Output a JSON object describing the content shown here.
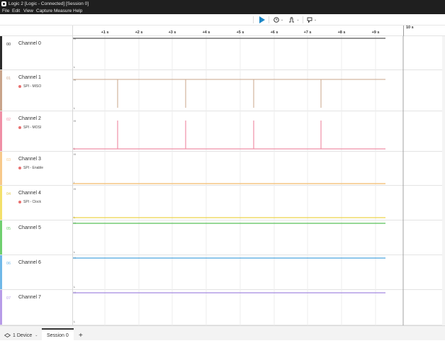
{
  "window": {
    "title": "Logic 2 [Logic - Connected] [Session 0]"
  },
  "menu": [
    "File",
    "Edit",
    "View",
    "Capture",
    "Measure",
    "Help"
  ],
  "toolbar": {
    "start_icon": "play-icon",
    "timer_icon": "clock-icon",
    "trigger_icon": "waveform-trigger-icon",
    "marker_icon": "marker-flag-icon"
  },
  "ruler": {
    "ticks": [
      "+1 s",
      "+2 s",
      "+3 s",
      "+4 s",
      "+5 s",
      "+6 s",
      "+7 s",
      "+8 s",
      "+9 s"
    ],
    "major": "10 s"
  },
  "channels": [
    {
      "num": "00",
      "name": "Channel 0",
      "color": "#2b2b2b",
      "analyzer": "",
      "high": "H",
      "low": "L"
    },
    {
      "num": "01",
      "name": "Channel 1",
      "color": "#c9a48a",
      "analyzer": "SPI - MISO",
      "high": "H",
      "low": "L"
    },
    {
      "num": "02",
      "name": "Channel 2",
      "color": "#ef8fa6",
      "analyzer": "SPI - MOSI",
      "high": "H",
      "low": "L"
    },
    {
      "num": "03",
      "name": "Channel 3",
      "color": "#f7c98a",
      "analyzer": "SPI - Enable",
      "high": "H",
      "low": "L"
    },
    {
      "num": "04",
      "name": "Channel 4",
      "color": "#f3e06a",
      "analyzer": "SPI - Clock",
      "high": "H",
      "low": "L"
    },
    {
      "num": "05",
      "name": "Channel 5",
      "color": "#6fcf6f",
      "analyzer": "",
      "high": "H",
      "low": "L"
    },
    {
      "num": "06",
      "name": "Channel 6",
      "color": "#6fb8e8",
      "analyzer": "",
      "high": "H",
      "low": "L"
    },
    {
      "num": "07",
      "name": "Channel 7",
      "color": "#b79be8",
      "analyzer": "",
      "high": "H",
      "low": "L"
    }
  ],
  "tabs": {
    "device": "1 Device",
    "session": "Session 0",
    "add": "+"
  }
}
